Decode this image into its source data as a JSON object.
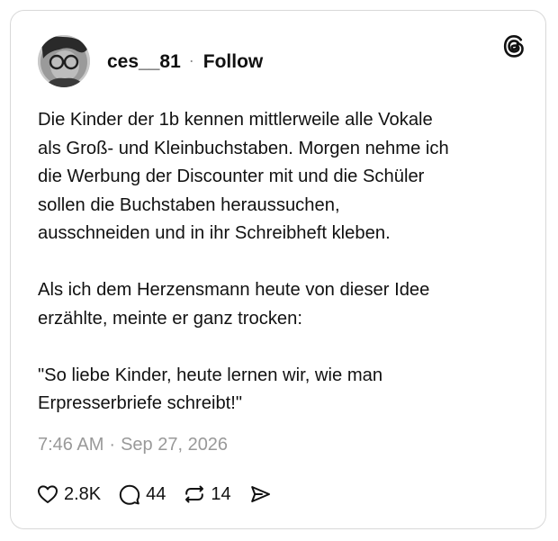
{
  "post": {
    "username": "ces__81",
    "separator": "·",
    "follow_label": "Follow",
    "paragraphs": [
      "Die Kinder der 1b kennen mittlerweile alle Vokale\nals Groß- und Kleinbuchstaben. Morgen nehme ich\ndie Werbung der Discounter mit und die Schüler\nsollen die Buchstaben heraussuchen,\nausschneiden und in ihr Schreibheft kleben.",
      "Als ich dem Herzensmann heute von dieser Idee\nerzählte, meinte er ganz trocken:",
      "\"So liebe Kinder, heute lernen wir, wie man\nErpresserbriefe schreibt!\""
    ],
    "time": "7:46 AM",
    "date_separator": "·",
    "date": "Sep 27, 2026"
  },
  "actions": {
    "likes": "2.8K",
    "replies": "44",
    "reposts": "14"
  },
  "icons": {
    "logo": "threads-logo-icon",
    "like": "heart-icon",
    "reply": "comment-bubble-icon",
    "repost": "repost-icon",
    "share": "send-icon"
  }
}
